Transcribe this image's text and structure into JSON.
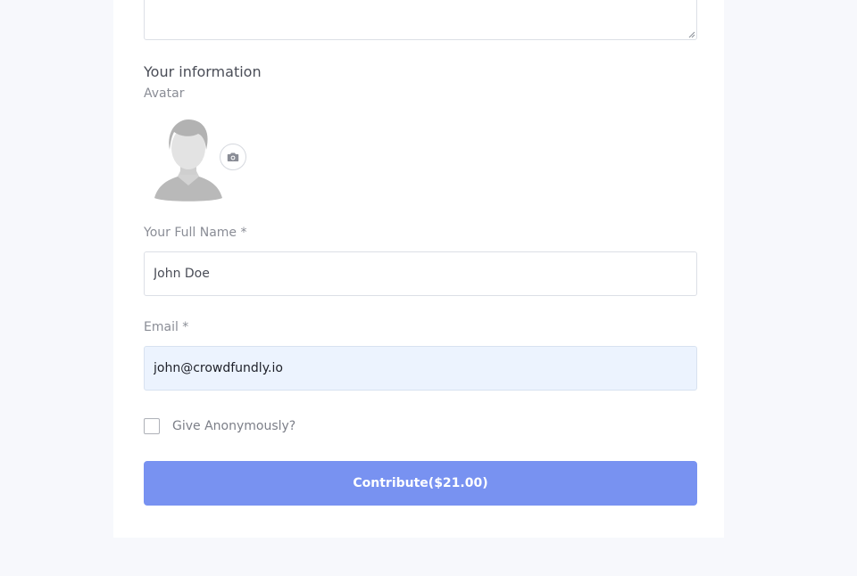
{
  "form": {
    "section_title": "Your information",
    "avatar": {
      "label": "Avatar",
      "image_icon": "default-person-silhouette-icon",
      "upload_icon": "camera-icon"
    },
    "full_name": {
      "label": "Your Full Name *",
      "value": "John Doe"
    },
    "email": {
      "label": "Email *",
      "value": "john@crowdfundly.io"
    },
    "anonymous": {
      "label": "Give Anonymously?",
      "checked": false
    },
    "submit_label": "Contribute($21.00)"
  },
  "colors": {
    "page_background": "#f7f8fc",
    "card_background": "#ffffff",
    "button_background": "#7892f1",
    "email_field_background": "#ecf3fe"
  }
}
